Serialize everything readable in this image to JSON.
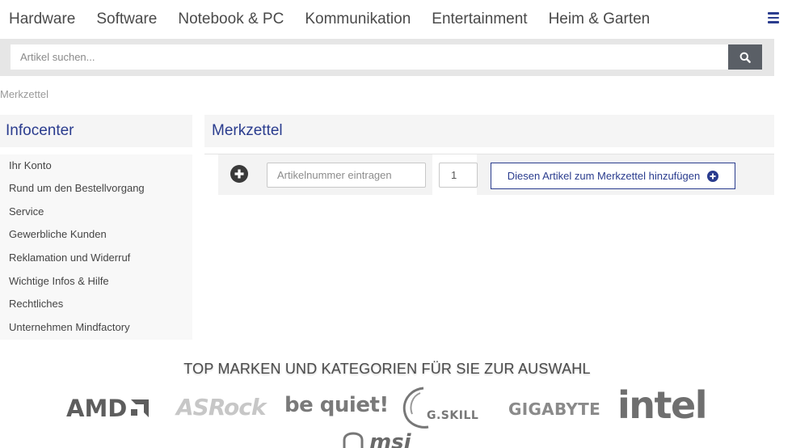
{
  "nav": {
    "items": [
      {
        "label": "Hardware"
      },
      {
        "label": "Software"
      },
      {
        "label": "Notebook & PC"
      },
      {
        "label": "Kommunikation"
      },
      {
        "label": "Entertainment"
      },
      {
        "label": "Heim & Garten"
      }
    ],
    "menu_icon": "hamburger-menu-icon"
  },
  "search": {
    "placeholder": "Artikel suchen...",
    "button_icon": "search-icon"
  },
  "breadcrumb": "Merkzettel",
  "sidebar": {
    "title": "Infocenter",
    "items": [
      {
        "label": "Ihr Konto"
      },
      {
        "label": "Rund um den Bestellvorgang"
      },
      {
        "label": "Service"
      },
      {
        "label": "Gewerbliche Kunden"
      },
      {
        "label": "Reklamation und Widerruf"
      },
      {
        "label": "Wichtige Infos & Hilfe"
      },
      {
        "label": "Rechtliches"
      },
      {
        "label": "Unternehmen Mindfactory"
      }
    ]
  },
  "main": {
    "title": "Merkzettel",
    "form": {
      "article_placeholder": "Artikelnummer eintragen",
      "quantity": "1",
      "add_label": "Diesen Artikel zum Merkzettel hinzufügen"
    }
  },
  "brands": {
    "title": "TOP MARKEN UND KATEGORIEN FÜR SIE ZUR AUSWAHL",
    "logos": [
      "AMD",
      "ASRock",
      "be quiet!",
      "G.SKILL",
      "GIGABYTE",
      "intel",
      "msi"
    ]
  },
  "colors": {
    "accent": "#2a3c8e",
    "searchbar_bg": "#e6e6e6",
    "search_button": "#5a5f66",
    "panel_bg": "#f5f5f5"
  }
}
